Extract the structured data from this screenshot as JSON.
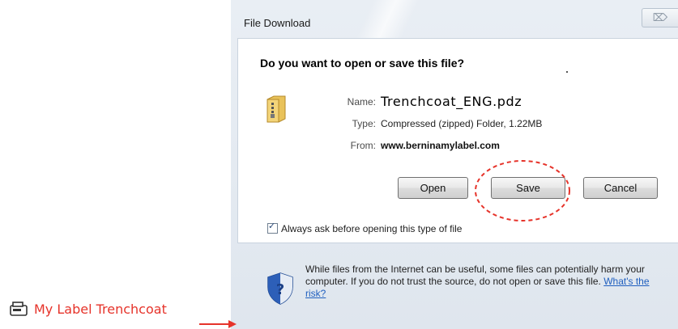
{
  "dialog": {
    "title": "File Download",
    "close_glyph": "⌦",
    "question": "Do you want to open or save this file?",
    "file": {
      "name_label": "Name:",
      "name_value": "Trenchcoat_ENG.pdz",
      "type_label": "Type:",
      "type_value": "Compressed (zipped) Folder, 1.22MB",
      "from_label": "From:",
      "from_value": "www.berninamylabel.com"
    },
    "buttons": {
      "open": "Open",
      "save": "Save",
      "cancel": "Cancel"
    },
    "checkbox": {
      "label": "Always ask before opening this type of file",
      "checked": true
    },
    "warning": {
      "text": "While files from the Internet can be useful, some files can potentially harm your computer. If you do not trust the source, do not open or save this file. ",
      "link": "What's the risk?"
    }
  },
  "annotation": {
    "label": "My Label Trenchcoat",
    "accent_color": "#e6332a"
  }
}
